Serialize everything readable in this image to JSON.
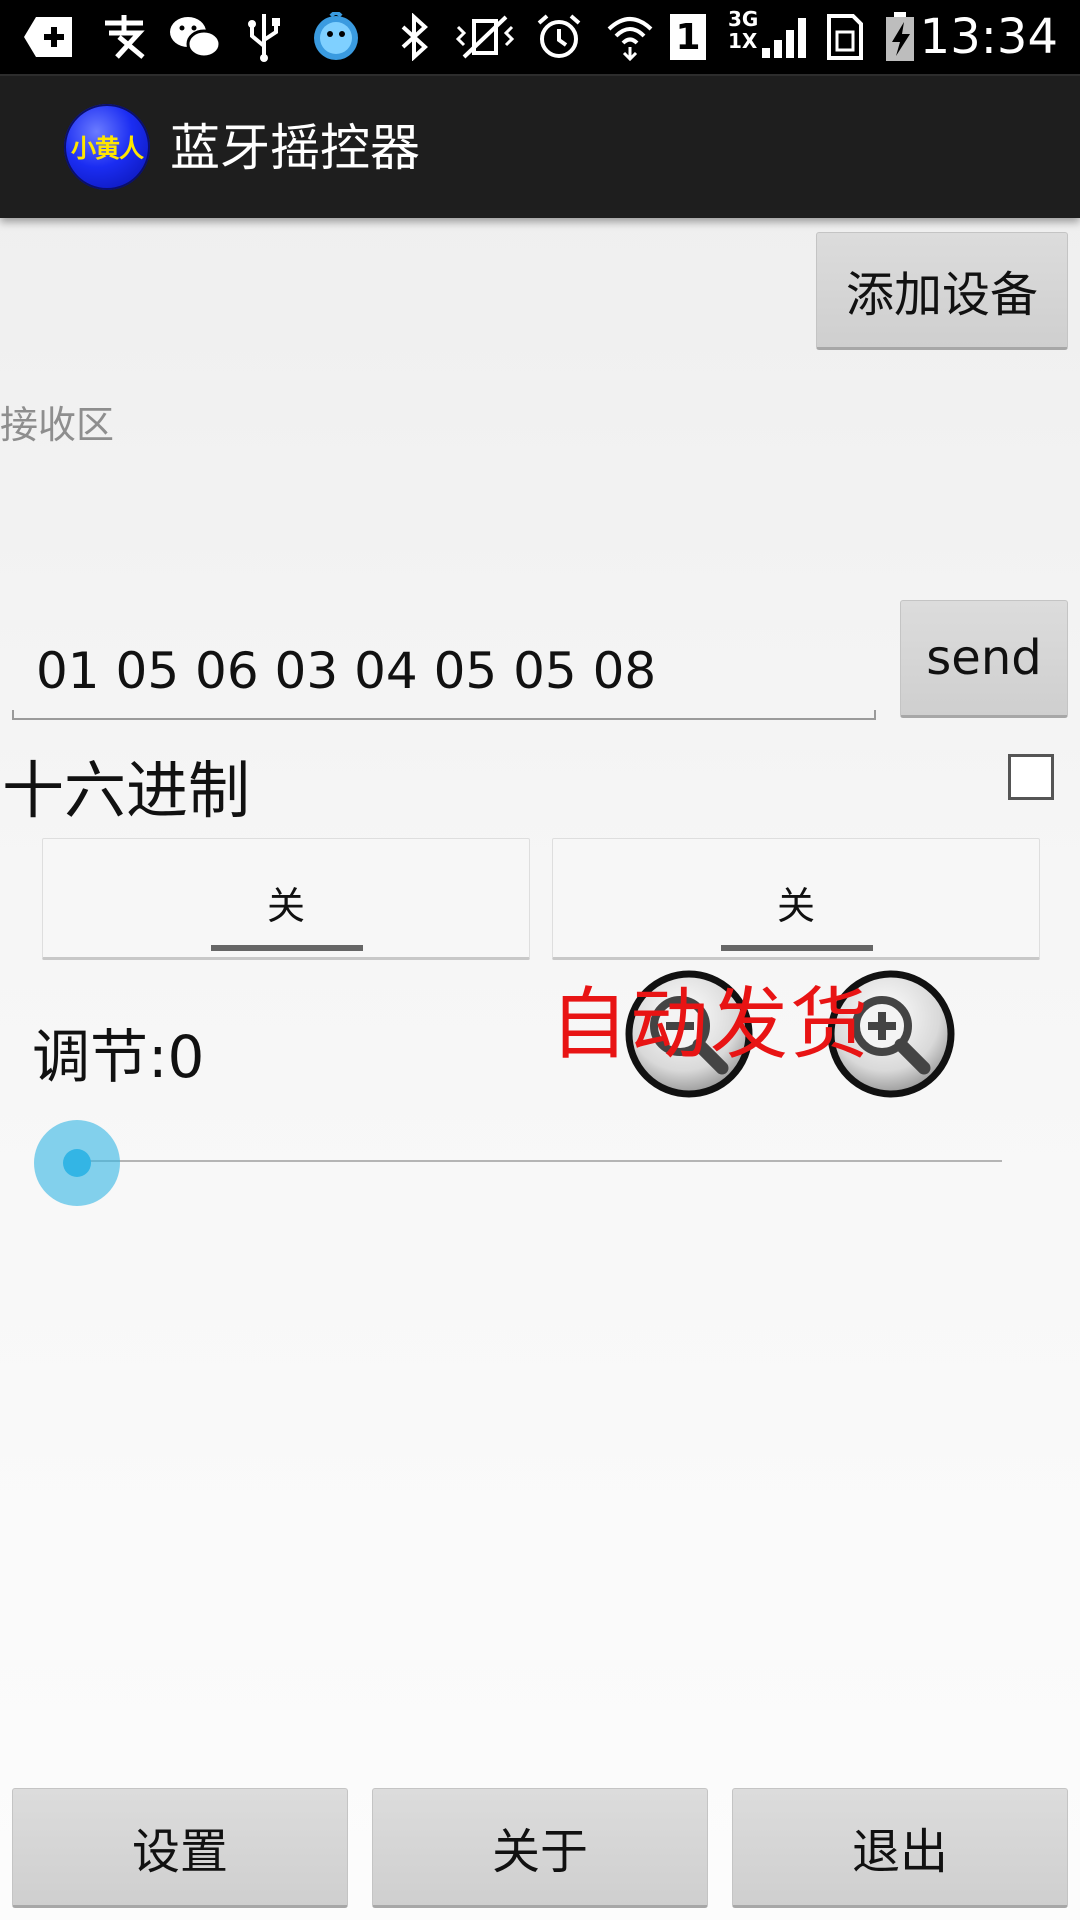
{
  "status_bar": {
    "time": "13:34",
    "network_label": "3G",
    "network_label_2": "1X",
    "sim_label": "1"
  },
  "app": {
    "logo_text": "小黄人",
    "title": "蓝牙摇控器"
  },
  "toolbar": {
    "add_device_label": "添加设备"
  },
  "receive": {
    "label": "接收区"
  },
  "send": {
    "input_value": "01 05 06 03 04 05 05 08",
    "button_label": "send"
  },
  "hex": {
    "label": "十六进制",
    "checked": false
  },
  "toggles": [
    {
      "label": "关",
      "on": false
    },
    {
      "label": "关",
      "on": false
    }
  ],
  "adjust": {
    "label": "调节:0",
    "value": 0
  },
  "watermark": "自动发货",
  "bottom_buttons": {
    "settings_label": "设置",
    "about_label": "关于",
    "exit_label": "退出"
  },
  "colors": {
    "accent": "#33b5e5",
    "watermark": "#e81414",
    "action_bar": "#1e1e1e"
  }
}
